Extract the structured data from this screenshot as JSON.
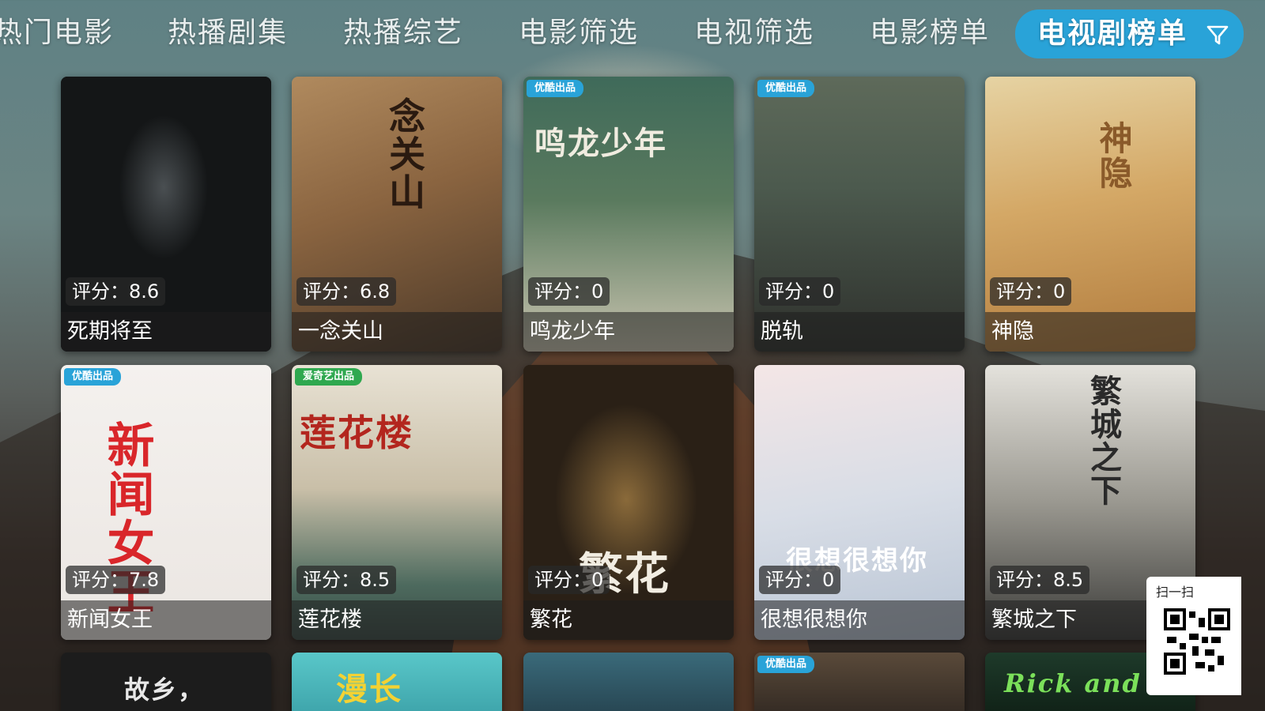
{
  "nav": {
    "tabs": [
      {
        "label": "热门电影"
      },
      {
        "label": "热播剧集"
      },
      {
        "label": "热播综艺"
      },
      {
        "label": "电影筛选"
      },
      {
        "label": "电视筛选"
      },
      {
        "label": "电影榜单"
      },
      {
        "label": "电视剧榜单"
      }
    ],
    "active_icon": "filter-icon",
    "accent_color": "#29a3d8"
  },
  "cards": [
    {
      "rating": "评分：8.6",
      "title": "死期将至",
      "poster_text": "",
      "badge": ""
    },
    {
      "rating": "评分：6.8",
      "title": "一念关山",
      "poster_text": "念关山",
      "badge": ""
    },
    {
      "rating": "评分：0",
      "title": "鸣龙少年",
      "poster_text": "鸣龙少年",
      "badge": "优酷出品"
    },
    {
      "rating": "评分：0",
      "title": "脱轨",
      "poster_text": "",
      "badge": "优酷出品"
    },
    {
      "rating": "评分：0",
      "title": "神隐",
      "poster_text": "神隐",
      "badge": ""
    },
    {
      "rating": "评分：7.8",
      "title": "新闻女王",
      "poster_text": "新闻女王",
      "badge": "优酷出品"
    },
    {
      "rating": "评分：8.5",
      "title": "莲花楼",
      "poster_text": "莲花楼",
      "badge": "爱奇艺出品"
    },
    {
      "rating": "评分：0",
      "title": "繁花",
      "poster_text": "繁花",
      "badge": ""
    },
    {
      "rating": "评分：0",
      "title": "很想很想你",
      "poster_text": "很想很想你",
      "badge": ""
    },
    {
      "rating": "评分：8.5",
      "title": "繁城之下",
      "poster_text": "繁城之下",
      "badge": ""
    }
  ],
  "partial_cards": [
    {
      "poster_text": "故乡，",
      "badge": ""
    },
    {
      "poster_text": "漫长",
      "badge": ""
    },
    {
      "poster_text": "",
      "badge": ""
    },
    {
      "poster_text": "",
      "badge": "优酷出品"
    },
    {
      "poster_text": "Rick and Morty",
      "badge": ""
    }
  ],
  "qr": {
    "label": "扫一扫"
  }
}
